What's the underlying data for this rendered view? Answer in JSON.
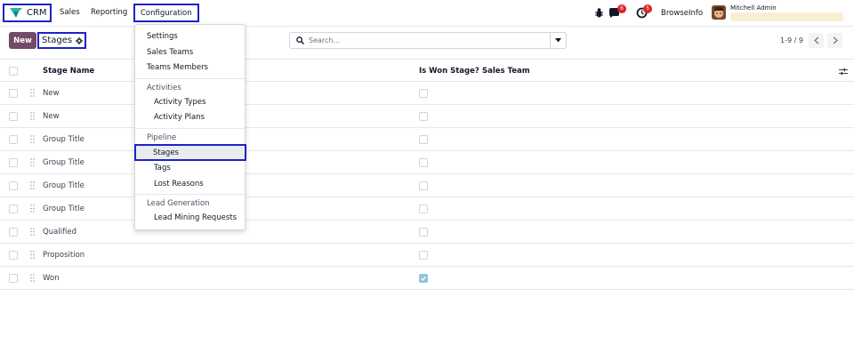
{
  "navbar": {
    "app_name": "CRM",
    "menus": [
      "Sales",
      "Reporting"
    ],
    "active_menu": "Configuration",
    "activity_count": "6",
    "timer_count": "5",
    "company": "BrowseInfo",
    "user": "Mitchell Admin"
  },
  "control": {
    "new_label": "New",
    "title": "Stages",
    "search_placeholder": "Search...",
    "pager": "1-9 / 9"
  },
  "table": {
    "columns": {
      "name": "Stage Name",
      "won": "Is Won Stage?",
      "team": "Sales Team"
    },
    "rows": [
      {
        "name": "New",
        "won": false
      },
      {
        "name": "New",
        "won": false
      },
      {
        "name": "Group Title",
        "won": false
      },
      {
        "name": "Group Title",
        "won": false
      },
      {
        "name": "Group Title",
        "won": false
      },
      {
        "name": "Group Title",
        "won": false
      },
      {
        "name": "Qualified",
        "won": false
      },
      {
        "name": "Proposition",
        "won": false
      },
      {
        "name": "Won",
        "won": true
      }
    ]
  },
  "config_menu": {
    "settings": "Settings",
    "sales_teams": "Sales Teams",
    "teams_members": "Teams Members",
    "activities_header": "Activities",
    "activity_types": "Activity Types",
    "activity_plans": "Activity Plans",
    "pipeline_header": "Pipeline",
    "stages": "Stages",
    "tags": "Tags",
    "lost_reasons": "Lost Reasons",
    "lead_gen_header": "Lead Generation",
    "lead_mining": "Lead Mining Requests"
  },
  "colors": {
    "brand": "#714b67",
    "highlight_border": "#1e22c7",
    "badge": "#dc2626",
    "checked": "#8fc3d9"
  }
}
